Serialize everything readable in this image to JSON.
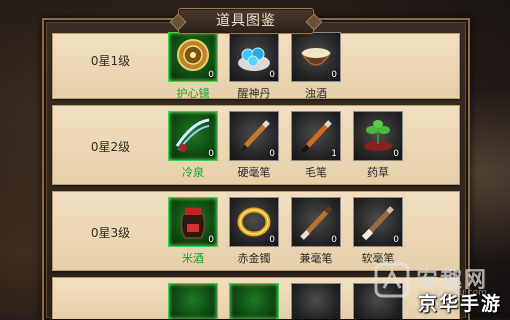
{
  "title": "道具图鉴",
  "tiers": [
    {
      "label": "0星1级",
      "items": [
        {
          "name": "护心镜",
          "count": "0",
          "selected": true,
          "icon": "mirror-icon"
        },
        {
          "name": "醒神丹",
          "count": "0",
          "selected": false,
          "icon": "pill-icon"
        },
        {
          "name": "浊酒",
          "count": "0",
          "selected": false,
          "icon": "wine-bowl-icon"
        }
      ]
    },
    {
      "label": "0星2级",
      "items": [
        {
          "name": "冷泉",
          "count": "0",
          "selected": true,
          "icon": "spring-icon"
        },
        {
          "name": "硬毫笔",
          "count": "0",
          "selected": false,
          "icon": "brush-icon"
        },
        {
          "name": "毛笔",
          "count": "1",
          "selected": false,
          "icon": "brush-icon"
        },
        {
          "name": "药草",
          "count": "0",
          "selected": false,
          "icon": "herb-icon"
        }
      ]
    },
    {
      "label": "0星3级",
      "items": [
        {
          "name": "米酒",
          "count": "0",
          "selected": true,
          "icon": "wine-jar-icon"
        },
        {
          "name": "赤金镯",
          "count": "0",
          "selected": false,
          "icon": "bracelet-icon"
        },
        {
          "name": "兼毫笔",
          "count": "0",
          "selected": false,
          "icon": "brush-icon"
        },
        {
          "name": "软毫笔",
          "count": "0",
          "selected": false,
          "icon": "brush-icon"
        }
      ]
    }
  ],
  "watermark": {
    "text": "安趣网",
    "url": "www.anqu.com"
  },
  "brand": "京华手游",
  "colors": {
    "selected_border": "#3fd14a",
    "selected_name": "#1d9d28",
    "panel": "#eddbb9"
  }
}
